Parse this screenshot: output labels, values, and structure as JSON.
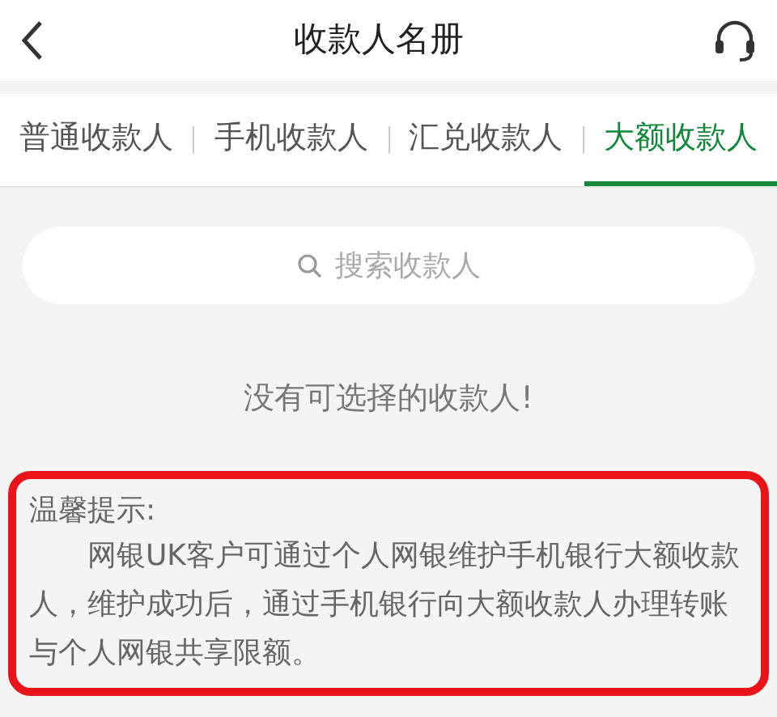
{
  "header": {
    "title": "收款人名册"
  },
  "tabs": [
    {
      "label": "普通收款人",
      "selected": false
    },
    {
      "label": "手机收款人",
      "selected": false
    },
    {
      "label": "汇兑收款人",
      "selected": false
    },
    {
      "label": "大额收款人",
      "selected": true
    }
  ],
  "search": {
    "placeholder": "搜索收款人"
  },
  "empty_message": "没有可选择的收款人!",
  "tip": {
    "title": "温馨提示:",
    "text": "网银UK客户可通过个人网银维护手机银行大额收款人，维护成功后，通过手机银行向大额收款人办理转账与个人网银共享限额。",
    "highlighted": true
  }
}
